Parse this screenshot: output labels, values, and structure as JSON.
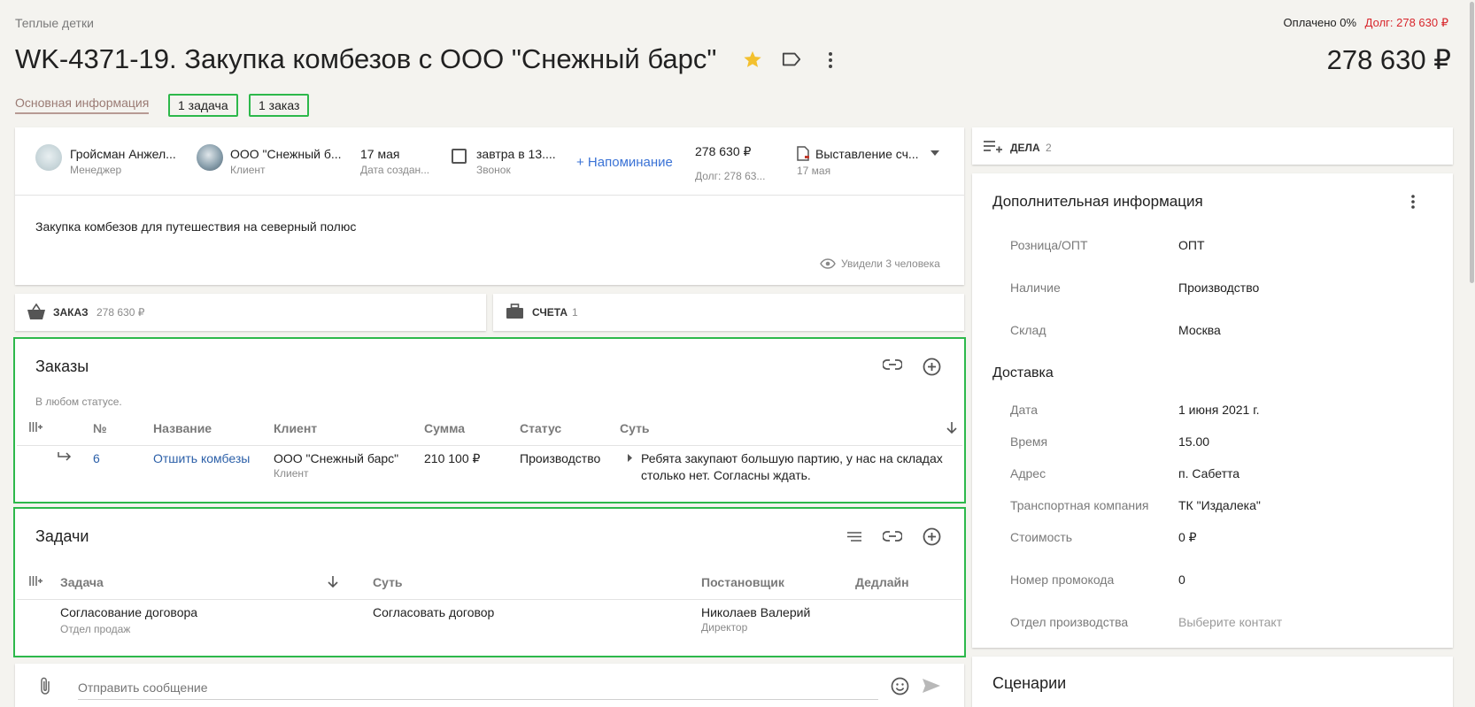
{
  "header": {
    "company": "Теплые детки",
    "paid_status": "Оплачено 0%",
    "debt": "Долг: 278 630 ₽",
    "title": "WK-4371-19. Закупка комбезов с ООО \"Снежный барс\"",
    "total": "278 630 ₽",
    "colors": {
      "star": "#f3c02e",
      "debt": "#d8262c",
      "highlight": "#2db84b",
      "link": "#2b5fa8"
    }
  },
  "tabs": {
    "main_info": "Основная информация",
    "tasks_chip": "1 задача",
    "orders_chip": "1 заказ"
  },
  "summary": {
    "manager_name": "Гройсман Анжел...",
    "manager_role": "Менеджер",
    "client_name": "ООО \"Снежный б...",
    "client_role": "Клиент",
    "created_date": "17 мая",
    "created_label": "Дата создан...",
    "call_time": "завтра в 13....",
    "call_label": "Звонок",
    "reminder": "+ Напоминание",
    "amount": "278 630 ₽",
    "amount_debt": "Долг: 278 63...",
    "stage": "Выставление сч...",
    "stage_date": "17 мая",
    "description": "Закупка комбезов для путешествия на северный полюс",
    "seen": "Увидели 3 человека"
  },
  "bars": {
    "order_label": "ЗАКАЗ",
    "order_amount": "278 630 ₽",
    "invoices_label": "СЧЕТА",
    "invoices_count": "1"
  },
  "orders": {
    "title": "Заказы",
    "filter": "В любом статусе.",
    "columns": [
      "№",
      "Название",
      "Клиент",
      "Сумма",
      "Статус",
      "Суть"
    ],
    "rows": [
      {
        "num": "6",
        "name": "Отшить комбезы",
        "client": "ООО \"Снежный барс\"",
        "client_role": "Клиент",
        "sum": "210 100 ₽",
        "status": "Производство",
        "essence_line1": "Ребята закупают большую партию, у нас на складах",
        "essence_line2": "столько нет. Согласны ждать."
      }
    ]
  },
  "tasks": {
    "title": "Задачи",
    "columns": [
      "Задача",
      "Суть",
      "Постановщик",
      "Дедлайн"
    ],
    "rows": [
      {
        "task": "Согласование договора",
        "dept": "Отдел продаж",
        "essence": "Согласовать договор",
        "author": "Николаев Валерий",
        "author_role": "Директор",
        "deadline": ""
      }
    ]
  },
  "composer": {
    "placeholder": "Отправить сообщение"
  },
  "right": {
    "deals_label": "ДЕЛА",
    "deals_count": "2",
    "extra_title": "Дополнительная информация",
    "fields": [
      {
        "label": "Розница/ОПТ",
        "value": "ОПТ"
      },
      {
        "label": "Наличие",
        "value": "Производство"
      },
      {
        "label": "Склад",
        "value": "Москва"
      }
    ],
    "delivery_title": "Доставка",
    "delivery": [
      {
        "label": "Дата",
        "value": "1 июня 2021 г."
      },
      {
        "label": "Время",
        "value": "15.00"
      },
      {
        "label": "Адрес",
        "value": "п. Сабетта"
      },
      {
        "label": "Транспортная компания",
        "value": "ТК \"Издалека\""
      },
      {
        "label": "Стоимость",
        "value": "0 ₽"
      }
    ],
    "promo_label": "Номер промокода",
    "promo_value": "0",
    "prod_label": "Отдел производства",
    "prod_value": "Выберите контакт",
    "scenarios_title": "Сценарии"
  }
}
